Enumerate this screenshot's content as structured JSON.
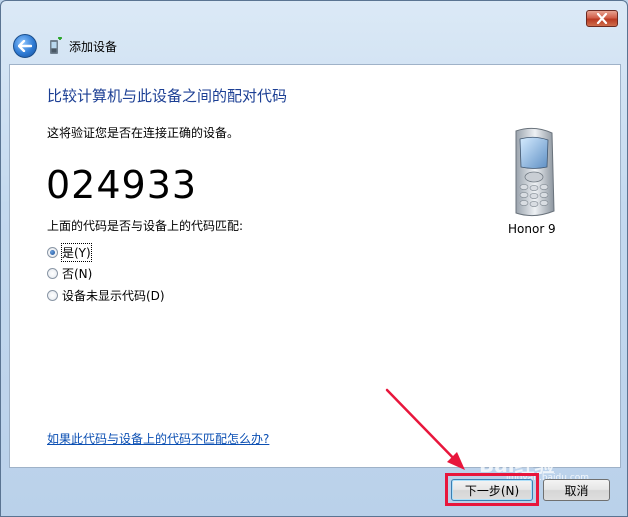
{
  "window": {
    "title": "添加设备",
    "close_icon": "close-icon",
    "back_icon": "back-arrow-icon",
    "title_icon": "add-device-icon"
  },
  "main": {
    "heading": "比较计算机与此设备之间的配对代码",
    "subtext": "这将验证您是否在连接正确的设备。",
    "pairing_code": "024933",
    "question": "上面的代码是否与设备上的代码匹配:",
    "options": [
      {
        "label": "是(Y)",
        "checked": true
      },
      {
        "label": "否(N)",
        "checked": false
      },
      {
        "label": "设备未显示代码(D)",
        "checked": false
      }
    ],
    "help_link": "如果此代码与设备上的代码不匹配怎么办?"
  },
  "device": {
    "name": "Honor 9",
    "icon": "mobile-phone-icon"
  },
  "footer": {
    "next_label": "下一步(N)",
    "cancel_label": "取消"
  },
  "annotation": {
    "color": "#e8163c"
  },
  "watermark": {
    "text": "Bai经验",
    "sub": "jingyan.baidu.com"
  }
}
